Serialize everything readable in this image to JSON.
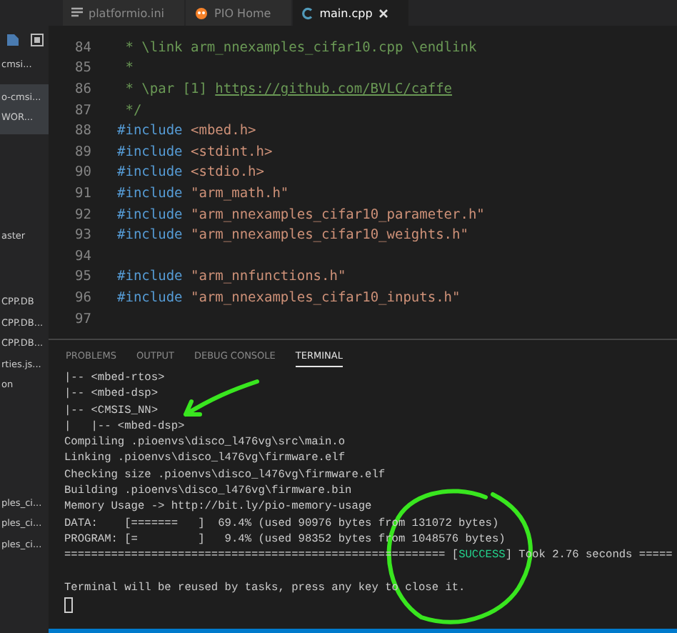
{
  "tabs": [
    {
      "label": "platformio.ini",
      "selected": false,
      "closable": false
    },
    {
      "label": "PIO Home",
      "selected": false,
      "closable": false
    },
    {
      "label": "main.cpp",
      "selected": true,
      "closable": true
    }
  ],
  "sidebar": {
    "groups": [
      {
        "highlighted": false,
        "items": [
          "cmsi..."
        ]
      },
      {
        "highlighted": true,
        "items": [
          "o-cmsi...",
          "WOR..."
        ]
      },
      {
        "highlighted": false,
        "items": [
          "aster"
        ]
      },
      {
        "highlighted": false,
        "items": [
          "CPP.DB",
          "CPP.DB...",
          "CPP.DB...",
          "rties.js...",
          "on"
        ]
      },
      {
        "highlighted": false,
        "items": [
          "ples_ci...",
          "ples_ci...",
          "ples_ci..."
        ]
      }
    ]
  },
  "code": [
    {
      "number": "84",
      "kind": "comment",
      "text": " * \\link arm_nnexamples_cifar10.cpp \\endlink"
    },
    {
      "number": "85",
      "kind": "comment",
      "text": " *"
    },
    {
      "number": "86",
      "kind": "comment",
      "text": " * \\par [1] ",
      "link": "https://github.com/BVLC/caffe"
    },
    {
      "number": "87",
      "kind": "comment",
      "text": " */"
    },
    {
      "number": "88",
      "kind": "include",
      "directive": "#include",
      "target": "<mbed.h>"
    },
    {
      "number": "89",
      "kind": "include",
      "directive": "#include",
      "target": "<stdint.h>"
    },
    {
      "number": "90",
      "kind": "include",
      "directive": "#include",
      "target": "<stdio.h>"
    },
    {
      "number": "91",
      "kind": "include",
      "directive": "#include",
      "target": "\"arm_math.h\""
    },
    {
      "number": "92",
      "kind": "include",
      "directive": "#include",
      "target": "\"arm_nnexamples_cifar10_parameter.h\""
    },
    {
      "number": "93",
      "kind": "include",
      "directive": "#include",
      "target": "\"arm_nnexamples_cifar10_weights.h\""
    },
    {
      "number": "94",
      "kind": "blank"
    },
    {
      "number": "95",
      "kind": "include",
      "directive": "#include",
      "target": "\"arm_nnfunctions.h\""
    },
    {
      "number": "96",
      "kind": "include",
      "directive": "#include",
      "target": "\"arm_nnexamples_cifar10_inputs.h\""
    },
    {
      "number": "97",
      "kind": "blank"
    }
  ],
  "panel_tabs": [
    {
      "label": "PROBLEMS",
      "selected": false
    },
    {
      "label": "OUTPUT",
      "selected": false
    },
    {
      "label": "DEBUG CONSOLE",
      "selected": false
    },
    {
      "label": "TERMINAL",
      "selected": true
    }
  ],
  "terminal": [
    {
      "kind": "text",
      "text": "|-- <mbed-rtos>"
    },
    {
      "kind": "text",
      "text": "|-- <mbed-dsp>"
    },
    {
      "kind": "text",
      "text": "|-- <CMSIS_NN>"
    },
    {
      "kind": "text",
      "text": "|   |-- <mbed-dsp>"
    },
    {
      "kind": "text",
      "text": "Compiling .pioenvs\\disco_l476vg\\src\\main.o"
    },
    {
      "kind": "text",
      "text": "Linking .pioenvs\\disco_l476vg\\firmware.elf"
    },
    {
      "kind": "text",
      "text": "Checking size .pioenvs\\disco_l476vg\\firmware.elf"
    },
    {
      "kind": "text",
      "text": "Building .pioenvs\\disco_l476vg\\firmware.bin"
    },
    {
      "kind": "text",
      "text": "Memory Usage -> http://bit.ly/pio-memory-usage"
    },
    {
      "kind": "text",
      "text": "DATA:    [=======   ]  69.4% (used 90976 bytes from 131072 bytes)"
    },
    {
      "kind": "text",
      "text": "PROGRAM: [=         ]   9.4% (used 98352 bytes from 1048576 bytes)"
    },
    {
      "kind": "status",
      "before": "========================================================= [",
      "status": "SUCCESS",
      "after": "] Took 2.76 seconds ====="
    },
    {
      "kind": "blank"
    },
    {
      "kind": "text",
      "text": "Terminal will be reused by tasks, press any key to close it."
    },
    {
      "kind": "cursor"
    }
  ]
}
